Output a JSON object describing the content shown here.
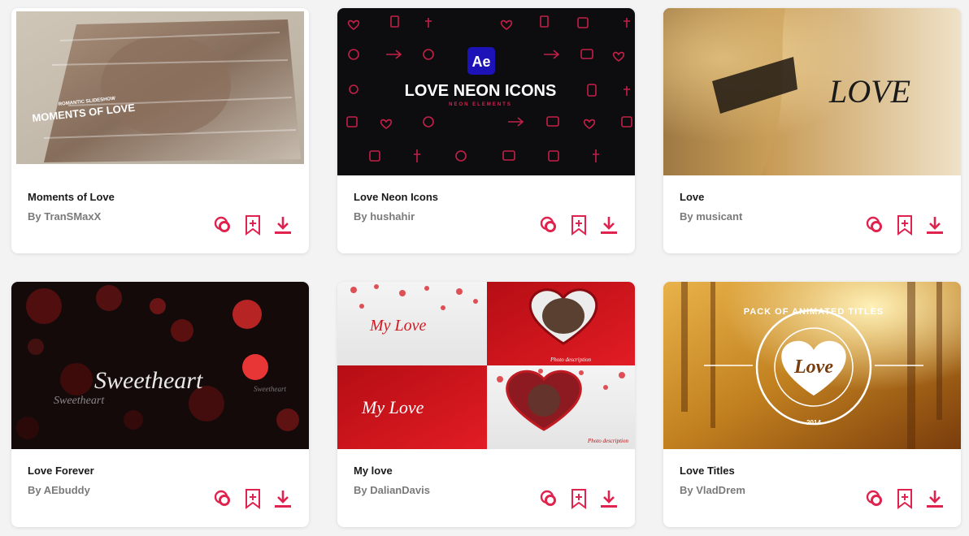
{
  "accent": "#e0224e",
  "cards": [
    {
      "title": "Moments of Love",
      "author": "By TranSMaxX",
      "thumb_text": [
        "ROMANTIC SLIDESHOW",
        "MOMENTS OF LOVE"
      ]
    },
    {
      "title": "Love Neon Icons",
      "author": "By hushahir",
      "thumb_text": [
        "Ae",
        "LOVE NEON ICONS",
        "NEON ELEMENTS"
      ]
    },
    {
      "title": "Love",
      "author": "By musicant",
      "thumb_text": [
        "LOVE"
      ]
    },
    {
      "title": "Love Forever",
      "author": "By AEbuddy",
      "thumb_text": [
        "Sweetheart",
        "Sweetheart",
        "Sweetheart"
      ]
    },
    {
      "title": "My love",
      "author": "By DalianDavis",
      "thumb_text": [
        "My Love",
        "My Love",
        "Photo description",
        "Photo description"
      ]
    },
    {
      "title": "Love Titles",
      "author": "By VladDrem",
      "thumb_text": [
        "Love",
        "PACK OF ANIMATED TITLES",
        "2014"
      ]
    }
  ],
  "action_icons": [
    "preview-icon",
    "bookmark-add-icon",
    "download-icon"
  ]
}
